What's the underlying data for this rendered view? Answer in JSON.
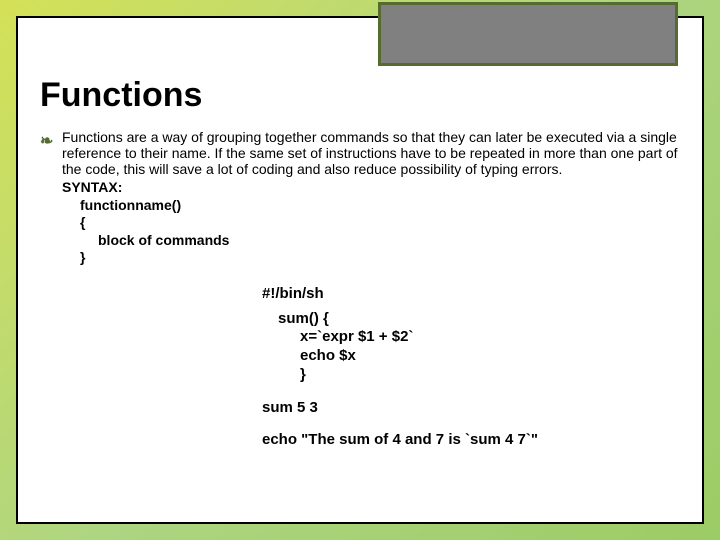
{
  "title": "Functions",
  "paragraph": "Functions are a way of grouping together commands so that they can later be executed via a single reference to their name. If the same set of instructions have to be repeated in more than one part of the code, this will save a lot of coding and also reduce possibility of typing errors.",
  "syntax": {
    "label": "SYNTAX:",
    "l1": "functionname()",
    "l2": "{",
    "l3": "block of commands",
    "l4": "}"
  },
  "code": {
    "shebang": "#!/bin/sh",
    "l1": "sum() {",
    "l2": "x=`expr $1 + $2`",
    "l3": "echo $x",
    "l4": "}",
    "call": "sum 5 3",
    "echo": "echo \"The sum of 4 and 7 is `sum 4 7`\""
  }
}
